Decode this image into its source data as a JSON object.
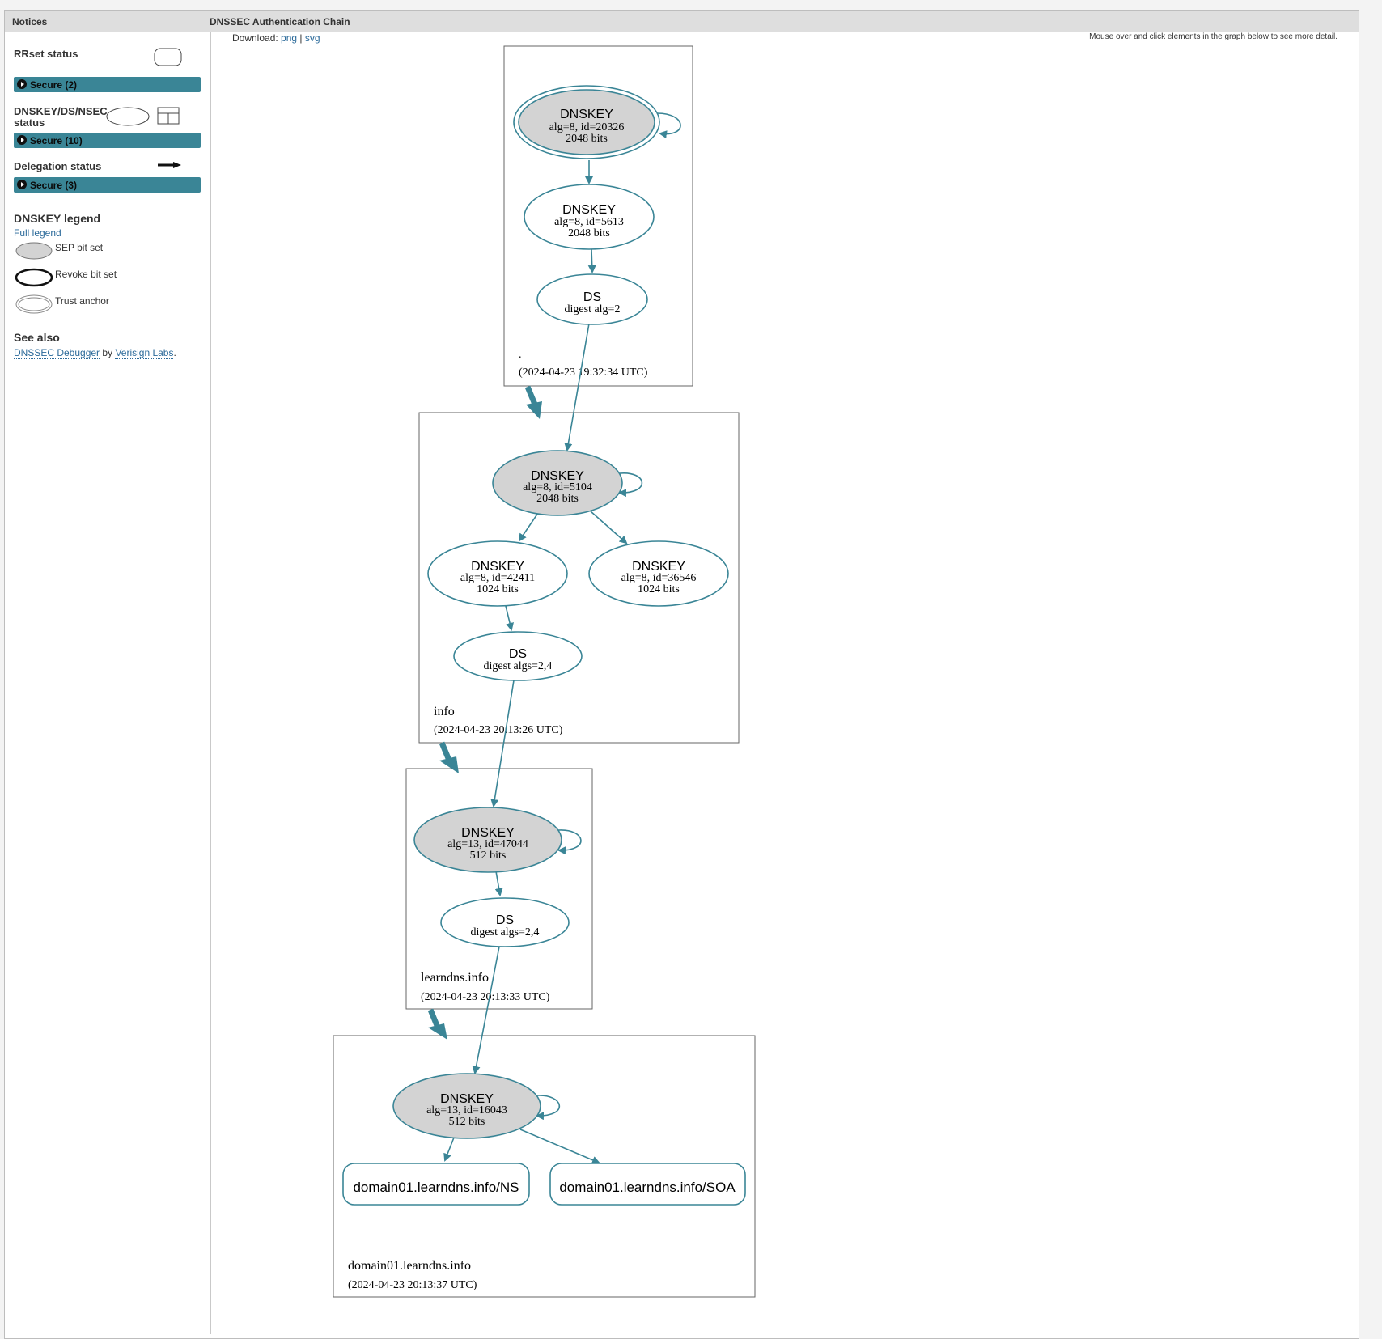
{
  "panels": {
    "notices_title": "Notices",
    "chain_title": "DNSSEC Authentication Chain"
  },
  "sidebar": {
    "rrset_status_label": "RRset status",
    "rrset_secure": "Secure (2)",
    "dnskey_status_label_line1": "DNSKEY/DS/NSEC",
    "dnskey_status_label_line2": "status",
    "dnskey_secure": "Secure (10)",
    "delegation_status_label": "Delegation status",
    "delegation_secure": "Secure (3)",
    "legend_title": "DNSKEY legend",
    "full_legend_link": "Full legend",
    "legend_items": [
      "SEP bit set",
      "Revoke bit set",
      "Trust anchor"
    ],
    "see_also_title": "See also",
    "see_also_link": "DNSSEC Debugger",
    "see_also_by": "by",
    "see_also_org": "Verisign Labs",
    "see_also_end": "."
  },
  "toolbar": {
    "download_label": "Download:",
    "png": "png",
    "sep": "|",
    "svg": "svg",
    "hint": "Mouse over and click elements in the graph below to see more detail."
  },
  "graph": {
    "zones": [
      {
        "name": ".",
        "timestamp": "(2024-04-23 19:32:34 UTC)"
      },
      {
        "name": "info",
        "timestamp": "(2024-04-23 20:13:26 UTC)"
      },
      {
        "name": "learndns.info",
        "timestamp": "(2024-04-23 20:13:33 UTC)"
      },
      {
        "name": "domain01.learndns.info",
        "timestamp": "(2024-04-23 20:13:37 UTC)"
      }
    ],
    "nodes": {
      "root_ksk": {
        "title": "DNSKEY",
        "l1": "alg=8, id=20326",
        "l2": "2048 bits"
      },
      "root_zsk": {
        "title": "DNSKEY",
        "l1": "alg=8, id=5613",
        "l2": "2048 bits"
      },
      "root_ds": {
        "title": "DS",
        "l1": "digest alg=2"
      },
      "info_ksk": {
        "title": "DNSKEY",
        "l1": "alg=8, id=5104",
        "l2": "2048 bits"
      },
      "info_zsk1": {
        "title": "DNSKEY",
        "l1": "alg=8, id=42411",
        "l2": "1024 bits"
      },
      "info_zsk2": {
        "title": "DNSKEY",
        "l1": "alg=8, id=36546",
        "l2": "1024 bits"
      },
      "info_ds": {
        "title": "DS",
        "l1": "digest algs=2,4"
      },
      "learn_ksk": {
        "title": "DNSKEY",
        "l1": "alg=13, id=47044",
        "l2": "512 bits"
      },
      "learn_ds": {
        "title": "DS",
        "l1": "digest algs=2,4"
      },
      "dom_ksk": {
        "title": "DNSKEY",
        "l1": "alg=13, id=16043",
        "l2": "512 bits"
      },
      "dom_ns": {
        "title": "domain01.learndns.info/NS"
      },
      "dom_soa": {
        "title": "domain01.learndns.info/SOA"
      }
    }
  },
  "colors": {
    "secure": "#3a8596",
    "sep_fill": "#d3d3d3",
    "edge": "#3a8596"
  }
}
